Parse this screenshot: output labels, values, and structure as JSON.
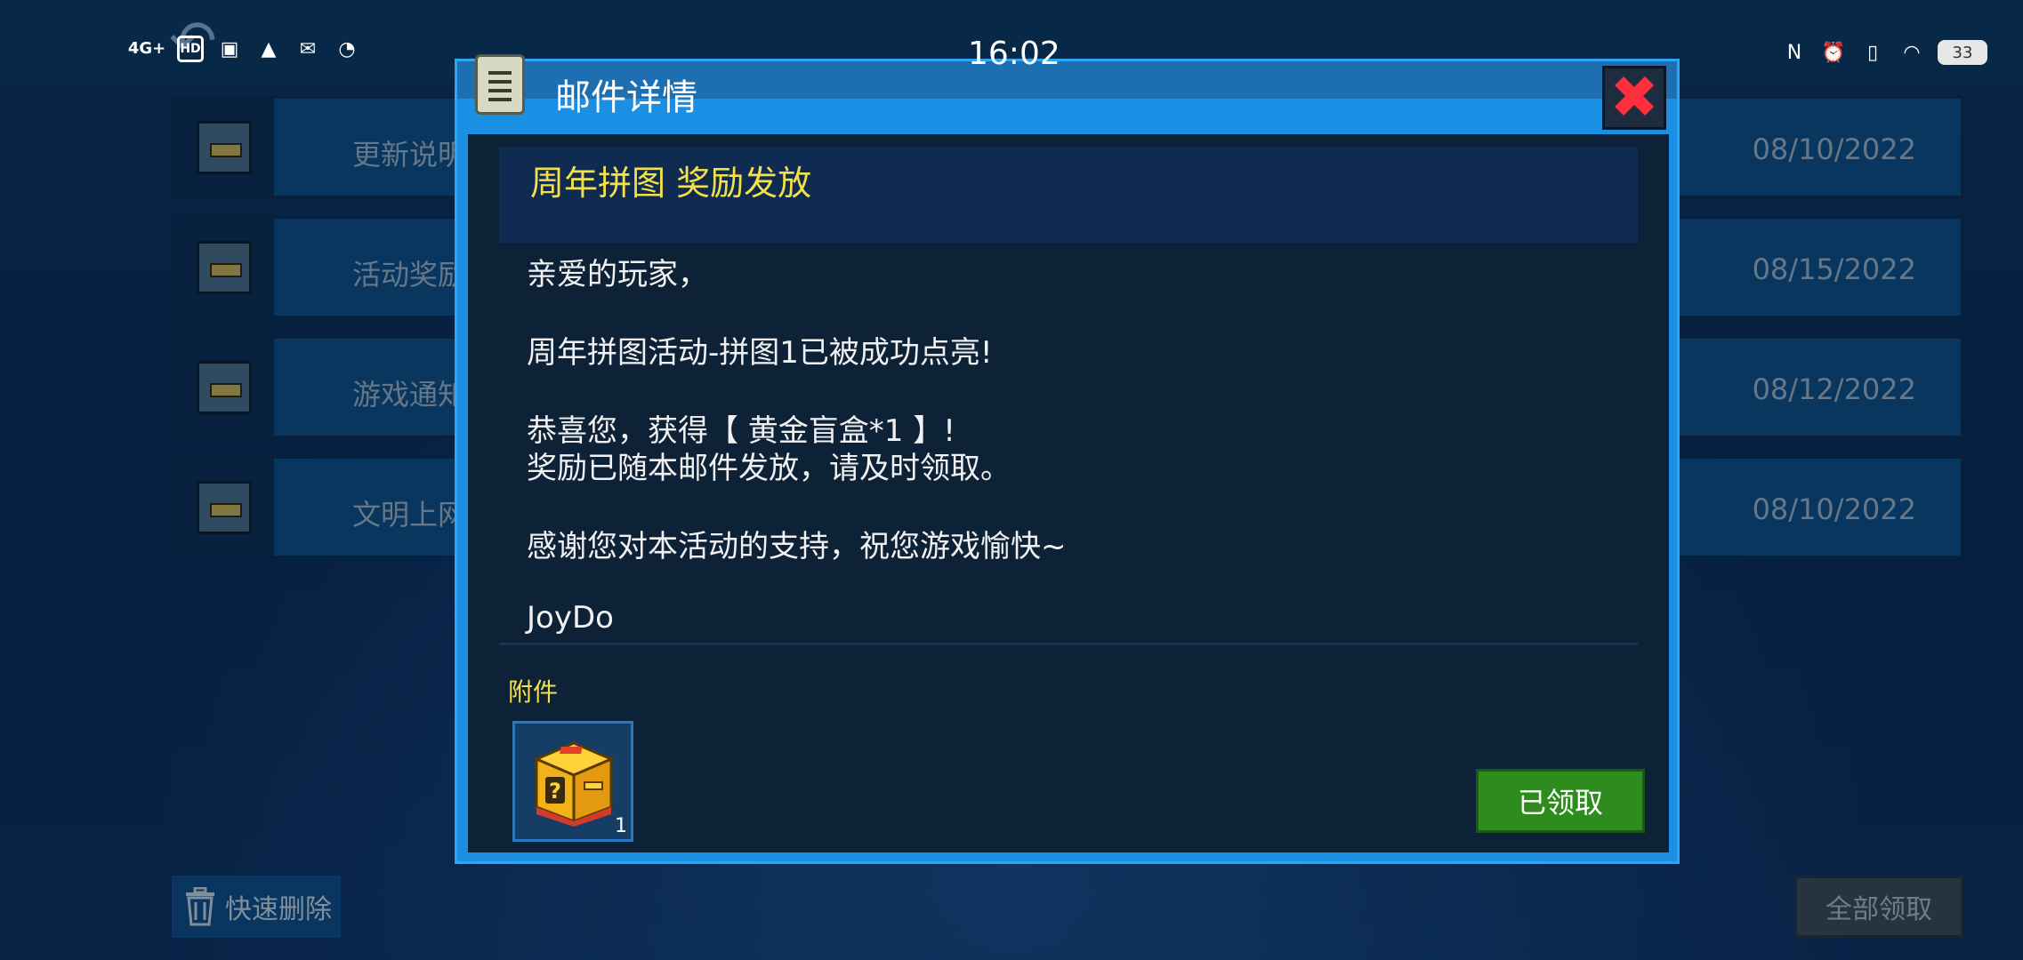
{
  "status_bar": {
    "time": "16:02",
    "network": "4G+",
    "hd": "HD",
    "battery": "33"
  },
  "mail_list": [
    {
      "title": "更新说明",
      "date": "08/10/2022"
    },
    {
      "title": "活动奖励",
      "date": "08/15/2022"
    },
    {
      "title": "游戏通知",
      "date": "08/12/2022"
    },
    {
      "title": "文明上网",
      "date": "08/10/2022"
    }
  ],
  "footer": {
    "quick_delete": "快速删除",
    "claim_all": "全部领取"
  },
  "dialog": {
    "title": "邮件详情",
    "mail_title": "周年拼图 奖励发放",
    "greeting": "亲爱的玩家，",
    "line1": "周年拼图活动-拼图1已被成功点亮!",
    "line2": "恭喜您，获得【 黄金盲盒*1 】!",
    "line3": "奖励已随本邮件发放，请及时领取。",
    "line4": "感谢您对本活动的支持，祝您游戏愉快~",
    "signature": "JoyDo",
    "attachment_label": "附件",
    "attachment_count": "1",
    "claimed_button": "已领取"
  }
}
